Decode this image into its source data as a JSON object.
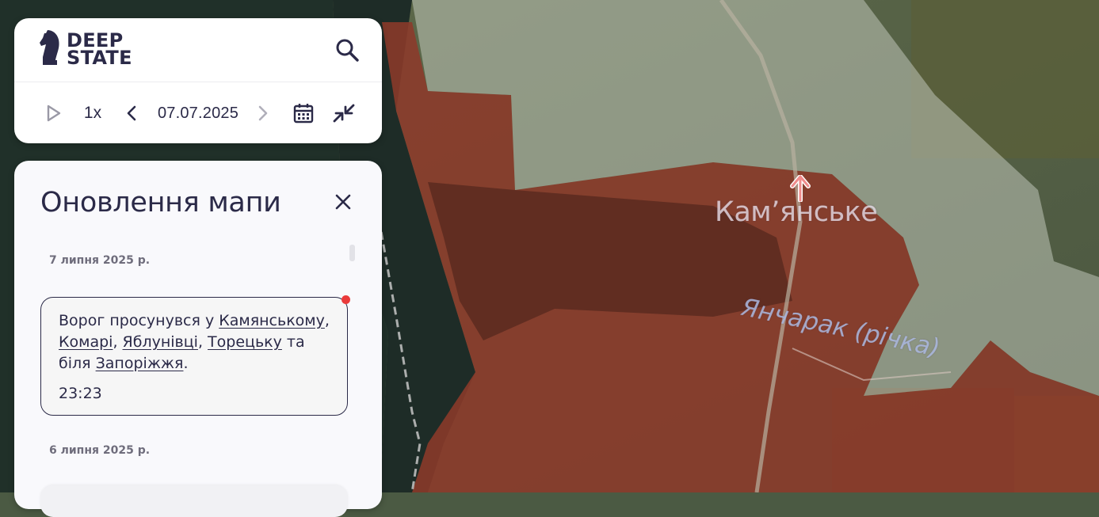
{
  "brand": {
    "line1": "DEEP",
    "line2": "STATE"
  },
  "icons": {
    "logo": "knight-chess-icon",
    "search": "search-icon",
    "play": "play-icon",
    "prev": "chevron-left-icon",
    "next": "chevron-right-icon",
    "calendar": "calendar-icon",
    "collapse": "collapse-arrows-icon",
    "close": "close-icon",
    "advance": "arrow-up-icon"
  },
  "timeline": {
    "speed": "1x",
    "date": "07.07.2025"
  },
  "updates": {
    "title": "Оновлення мапи",
    "days": [
      {
        "date": "7 липня 2025 р.",
        "entries": [
          {
            "text_1": "Ворог просунувся у ",
            "link_1": "Камянському",
            "text_2": ", ",
            "link_2": "Комарі",
            "text_3": ", ",
            "link_3": "Яблунівці",
            "text_4": ", ",
            "link_4": "Торецьку",
            "text_5": " та біля ",
            "link_5": "Запоріжжя",
            "text_6": ".",
            "time": "23:23",
            "unread": true
          }
        ]
      },
      {
        "date": "6 липня 2025 р.",
        "entries": []
      }
    ]
  },
  "map": {
    "city_label": "Кам’янське",
    "river_label": "Янчарак (річка)",
    "colors": {
      "occupied": "#8c3a2a",
      "grey_zone": "#c9cfc4",
      "water": "#1c2a26",
      "accent_arrow": "#f08c8c",
      "unread_dot": "#ea3a3a",
      "text_dark": "#2b2a48"
    }
  }
}
